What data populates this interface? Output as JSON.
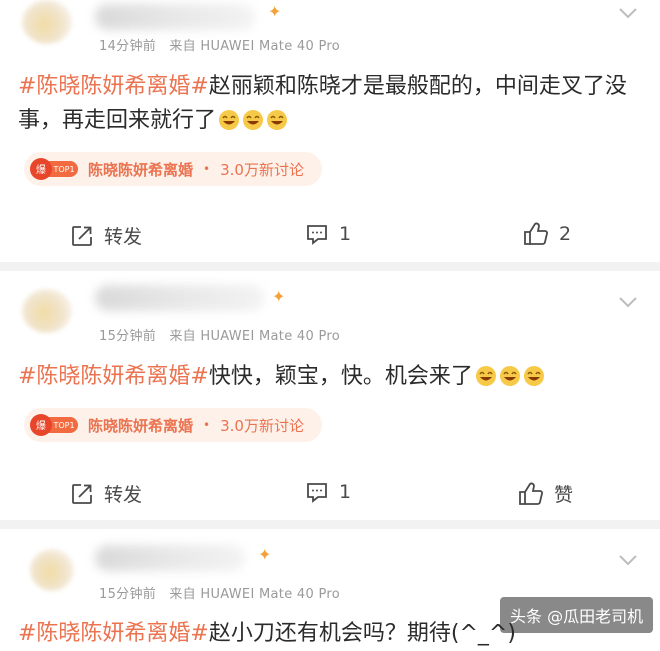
{
  "posts": [
    {
      "meta_time": "14分钟前",
      "meta_from": "来自",
      "meta_device": "HUAWEI Mate 40 Pro",
      "hashtag": "#陈晓陈妍希离婚#",
      "text": "赵丽颖和陈晓才是最般配的，中间走叉了没事，再走回来就行了",
      "topic": {
        "badge": "TOP1",
        "name": "陈晓陈妍希离婚",
        "count": "3.0万新讨论"
      },
      "forward_label": "转发",
      "comment_count": "1",
      "like_label": "2"
    },
    {
      "meta_time": "15分钟前",
      "meta_from": "来自",
      "meta_device": "HUAWEI Mate 40 Pro",
      "hashtag": "#陈晓陈妍希离婚#",
      "text": "快快，颖宝，快。机会来了",
      "topic": {
        "badge": "TOP1",
        "name": "陈晓陈妍希离婚",
        "count": "3.0万新讨论"
      },
      "forward_label": "转发",
      "comment_count": "1",
      "like_label": "赞"
    },
    {
      "meta_time": "15分钟前",
      "meta_from": "来自",
      "meta_device": "HUAWEI Mate 40 Pro",
      "hashtag": "#陈晓陈妍希离婚#",
      "text": "赵小刀还有机会吗？期待(^_^)"
    }
  ],
  "watermark": "头条 @瓜田老司机",
  "colors": {
    "accent": "#eb7350",
    "topic_bg": "#fdf1ea",
    "meta": "#9a9a9a"
  },
  "icons": [
    "chevron-down-icon",
    "forward-icon",
    "comment-icon",
    "like-icon",
    "hot-badge-icon",
    "laughing-emoji-icon"
  ]
}
